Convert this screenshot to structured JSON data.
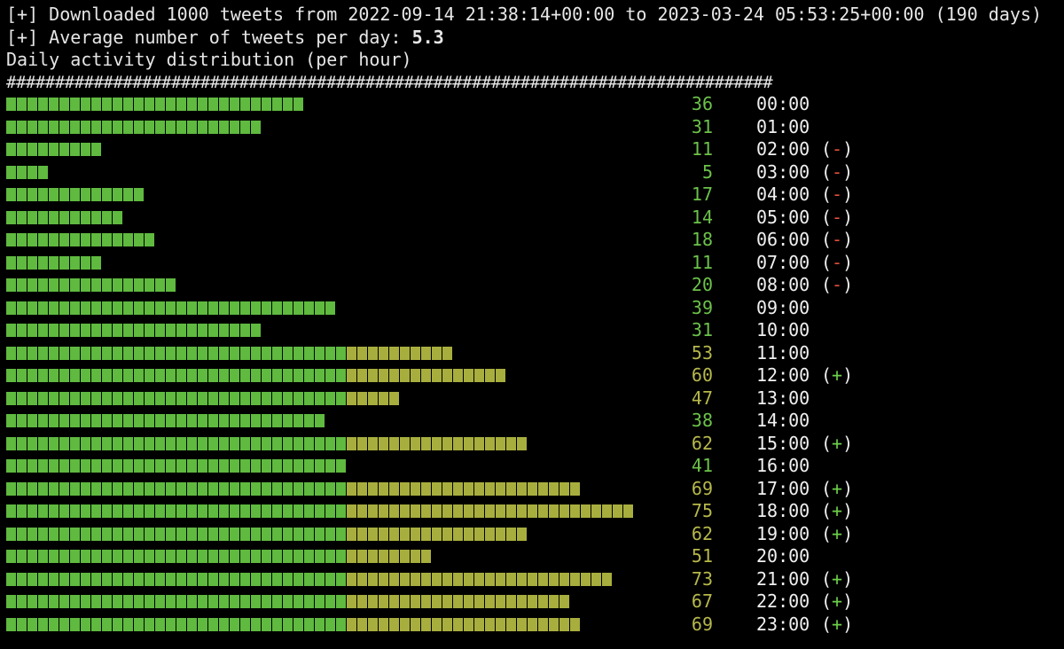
{
  "header": {
    "line1": "[+] Downloaded 1000 tweets from 2022-09-14 21:38:14+00:00 to 2023-03-24 05:53:25+00:00 (190 days)",
    "line2_prefix": "[+] Average number of tweets per day: ",
    "line2_value": "5.3",
    "line3": "Daily activity distribution (per hour)",
    "separator": "###############################################################################"
  },
  "colors": {
    "green": "#5fba3f",
    "yellow": "#a8ae3d",
    "minus": "#e0503a",
    "plus": "#6cd04a"
  },
  "chart_data": {
    "type": "bar",
    "categories": [
      "00:00",
      "01:00",
      "02:00",
      "03:00",
      "04:00",
      "05:00",
      "06:00",
      "07:00",
      "08:00",
      "09:00",
      "10:00",
      "11:00",
      "12:00",
      "13:00",
      "14:00",
      "15:00",
      "16:00",
      "17:00",
      "18:00",
      "19:00",
      "20:00",
      "21:00",
      "22:00",
      "23:00"
    ],
    "values": [
      36,
      31,
      11,
      5,
      17,
      14,
      18,
      11,
      20,
      39,
      31,
      53,
      60,
      47,
      38,
      62,
      41,
      69,
      75,
      62,
      51,
      73,
      67,
      69
    ],
    "flags": [
      "",
      "",
      "(-)",
      "(-)",
      "(-)",
      "(-)",
      "(-)",
      "(-)",
      "(-)",
      "",
      "",
      "",
      "(+)",
      "",
      "",
      "(+)",
      "",
      "(+)",
      "(+)",
      "(+)",
      "",
      "(+)",
      "(+)",
      "(+)"
    ],
    "threshold": 41
  }
}
